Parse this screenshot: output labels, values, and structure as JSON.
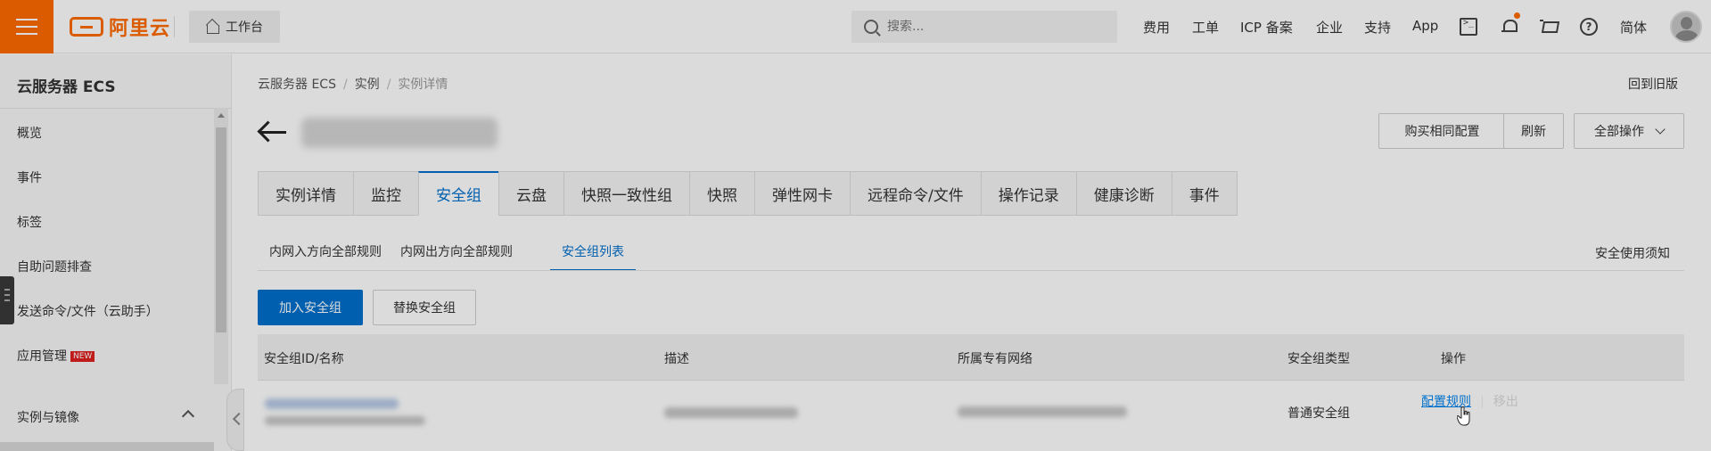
{
  "topbar": {
    "logo_text": "阿里云",
    "workbench_label": "工作台",
    "search_placeholder": "搜索...",
    "nav": [
      "费用",
      "工单",
      "ICP 备案",
      "企业",
      "支持",
      "App"
    ],
    "language": "简体",
    "brand_color": "#ff6a00"
  },
  "sidebar": {
    "title": "云服务器 ECS",
    "items": [
      "概览",
      "事件",
      "标签",
      "自助问题排查",
      "发送命令/文件（云助手）",
      "应用管理"
    ],
    "new_badge": "NEW",
    "section": "实例与镜像"
  },
  "breadcrumb": [
    "云服务器 ECS",
    "实例",
    "实例详情"
  ],
  "back_to_old": "回到旧版",
  "header_buttons": {
    "buy_same": "购买相同配置",
    "refresh": "刷新",
    "all_actions": "全部操作"
  },
  "tabs": [
    "实例详情",
    "监控",
    "安全组",
    "云盘",
    "快照一致性组",
    "快照",
    "弹性网卡",
    "远程命令/文件",
    "操作记录",
    "健康诊断",
    "事件"
  ],
  "active_tab": "安全组",
  "subtabs": [
    "内网入方向全部规则",
    "内网出方向全部规则",
    "安全组列表"
  ],
  "active_subtab": "安全组列表",
  "security_notice": "安全使用须知",
  "actions": {
    "join": "加入安全组",
    "replace": "替换安全组"
  },
  "table": {
    "headers": [
      "安全组ID/名称",
      "描述",
      "所属专有网络",
      "安全组类型",
      "操作"
    ],
    "rows": [
      {
        "type": "普通安全组",
        "configure": "配置规则",
        "remove": "移出"
      }
    ]
  },
  "accent_color": "#0070cc"
}
